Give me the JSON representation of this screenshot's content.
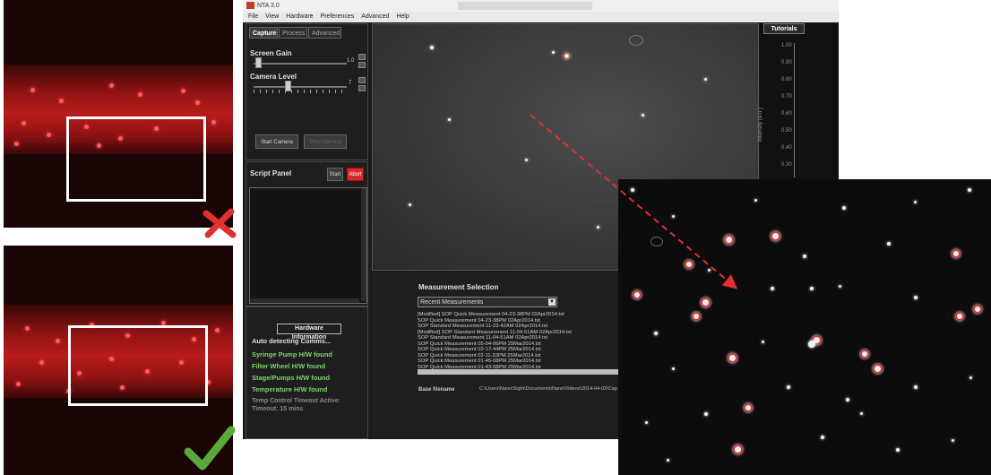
{
  "app": {
    "title": "NTA 3.0",
    "menu": [
      "File",
      "View",
      "Hardware",
      "Preferences",
      "Advanced",
      "Help"
    ]
  },
  "capture_panel": {
    "tabs": [
      "Capture",
      "Process",
      "Advanced"
    ],
    "screen_gain_label": "Screen Gain",
    "screen_gain_value": "1.0",
    "camera_level_label": "Camera Level",
    "camera_level_value": "7",
    "start_camera_label": "Start Camera",
    "stop_camera_label": "Stop Camera"
  },
  "script_panel": {
    "title": "Script Panel",
    "start_label": "Start",
    "abort_label": "Abort"
  },
  "hardware": {
    "title": "Hardware Information",
    "lines": [
      "Auto detecting Comms...",
      "Syringe Pump H/W found",
      "Filter Wheel H/W found",
      "Stage/Pumps H/W found",
      "Temperature H/W found"
    ],
    "timeout_lines": [
      "Temp Control Timeout Active:",
      "Timeout: 15 mins"
    ]
  },
  "tutorials": {
    "tab_label": "Tutorials",
    "y_axis_label": "Intensity (a.u.)",
    "y_ticks": [
      "1.00",
      "0.90",
      "0.80",
      "0.70",
      "0.60",
      "0.50",
      "0.40",
      "0.30"
    ]
  },
  "measurement": {
    "title": "Measurement Selection",
    "dropdown_value": "Recent Measurements",
    "list": [
      "[Modified] SOP Quick Measurement 04-23-38PM 02Apr2014.txt",
      "SOP Quick Measurement 04-23-38PM 02Apr2014.txt",
      "SOP Standard Measurement 11-23-42AM 02Apr2014.txt",
      "[Modified] SOP Standard Measurement 11-04-51AM 02Apr2014.txt",
      "SOP Standard Measurement 11-04-51AM 02Apr2014.txt",
      "SOP Quick Measurement 05-04-06PM 25Mar2014.txt",
      "SOP Quick Measurement 02-17-44PM 25Mar2014.txt",
      "SOP Quick Measurement 02-11-33PM 25Mar2014.txt",
      "SOP Quick Measurement 01-45-08PM 25Mar2014.txt",
      "SOP Quick Measurement 01-43-08PM 25Mar2014.txt"
    ],
    "filename_label": "Base filename",
    "filename_value": "C:\\Users\\Nano\\Sight\\Documents\\Nano\\Videos\\2014-04-02\\Cap"
  },
  "colors": {
    "accent_red": "#e03030",
    "check_green": "#5aa83a",
    "found_green": "#7fd36e"
  }
}
